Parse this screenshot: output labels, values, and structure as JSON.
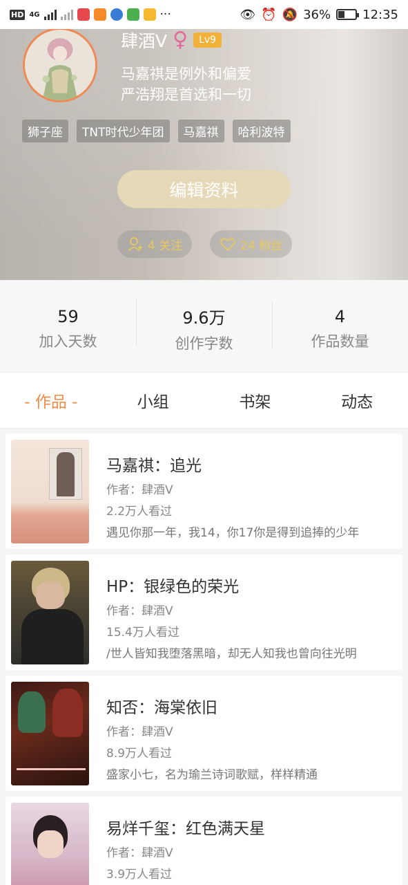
{
  "status_bar": {
    "network_label": "HD",
    "network_type": "4G",
    "more_indicator": "···",
    "battery_percent": "36%",
    "battery_level": 0.36,
    "time": "12:35"
  },
  "profile": {
    "username": "肆酒V",
    "gender_symbol": "♀",
    "level": "Lv9",
    "bio_line1": "马嘉祺是例外和偏爱",
    "bio_line2": "严浩翔是首选和一切",
    "tags": [
      "狮子座",
      "TNT时代少年团",
      "马嘉祺",
      "哈利波特"
    ],
    "edit_button": "编辑资料",
    "following": "4 关注",
    "followers": "24 粉丝"
  },
  "stats": [
    {
      "value": "59",
      "label": "加入天数"
    },
    {
      "value": "9.6万",
      "label": "创作字数"
    },
    {
      "value": "4",
      "label": "作品数量"
    }
  ],
  "tabs": [
    "- 作品 -",
    "小组",
    "书架",
    "动态"
  ],
  "works": [
    {
      "title": "马嘉祺：追光",
      "author": "作者：肆酒V",
      "views": "2.2万人看过",
      "desc": "遇见你那一年，我14，你17你是得到追捧的少年"
    },
    {
      "title": "HP：银绿色的荣光",
      "author": "作者：肆酒V",
      "views": "15.4万人看过",
      "desc": "/世人皆知我堕落黑暗，却无人知我也曾向往光明"
    },
    {
      "title": "知否：海棠依旧",
      "author": "作者：肆酒V",
      "views": "8.9万人看过",
      "desc": "盛家小七，名为瑜兰诗词歌赋，样样精通"
    },
    {
      "title": "易烊千玺：红色满天星",
      "author": "作者：肆酒V",
      "views": "3.9万人看过",
      "desc": ""
    }
  ]
}
